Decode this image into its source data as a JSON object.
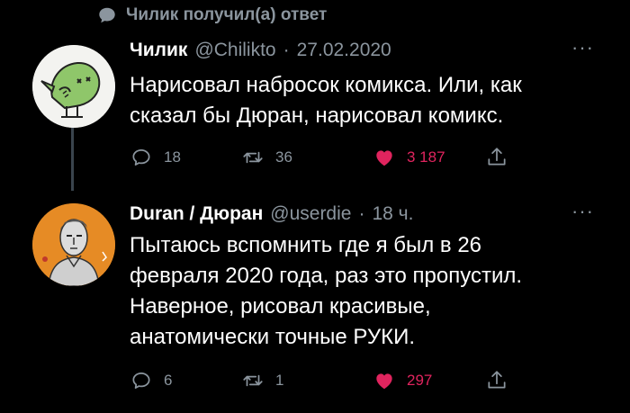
{
  "context": {
    "icon": "speech-bubble-icon",
    "text": "Чилик получил(а) ответ"
  },
  "tweets": [
    {
      "name": "Чилик",
      "handle": "@Chilikto",
      "separator": "·",
      "time": "27.02.2020",
      "more": "···",
      "avatar": "bird-avatar",
      "lines": [
        "Нарисовал набросок комикса. Или, как",
        "сказал бы Дюран, нарисовал комикс."
      ],
      "replies": "18",
      "retweets": "36",
      "likes": "3 187",
      "liked": true
    },
    {
      "name": "Duran / Дюран",
      "handle": "@userdie",
      "separator": "·",
      "time": "18 ч.",
      "more": "···",
      "avatar": "sketch-portrait-avatar",
      "lines": [
        "Пытаюсь вспомнить где я был в 26",
        "февраля 2020 года, раз это пропустил.",
        "Наверное, рисовал красивые,",
        "анатомически точные РУКИ."
      ],
      "replies": "6",
      "retweets": "1",
      "likes": "297",
      "liked": true
    }
  ],
  "colors": {
    "background": "#000000",
    "muted": "#8b959e",
    "like": "#e0245e",
    "bird": "#8fc66a"
  }
}
